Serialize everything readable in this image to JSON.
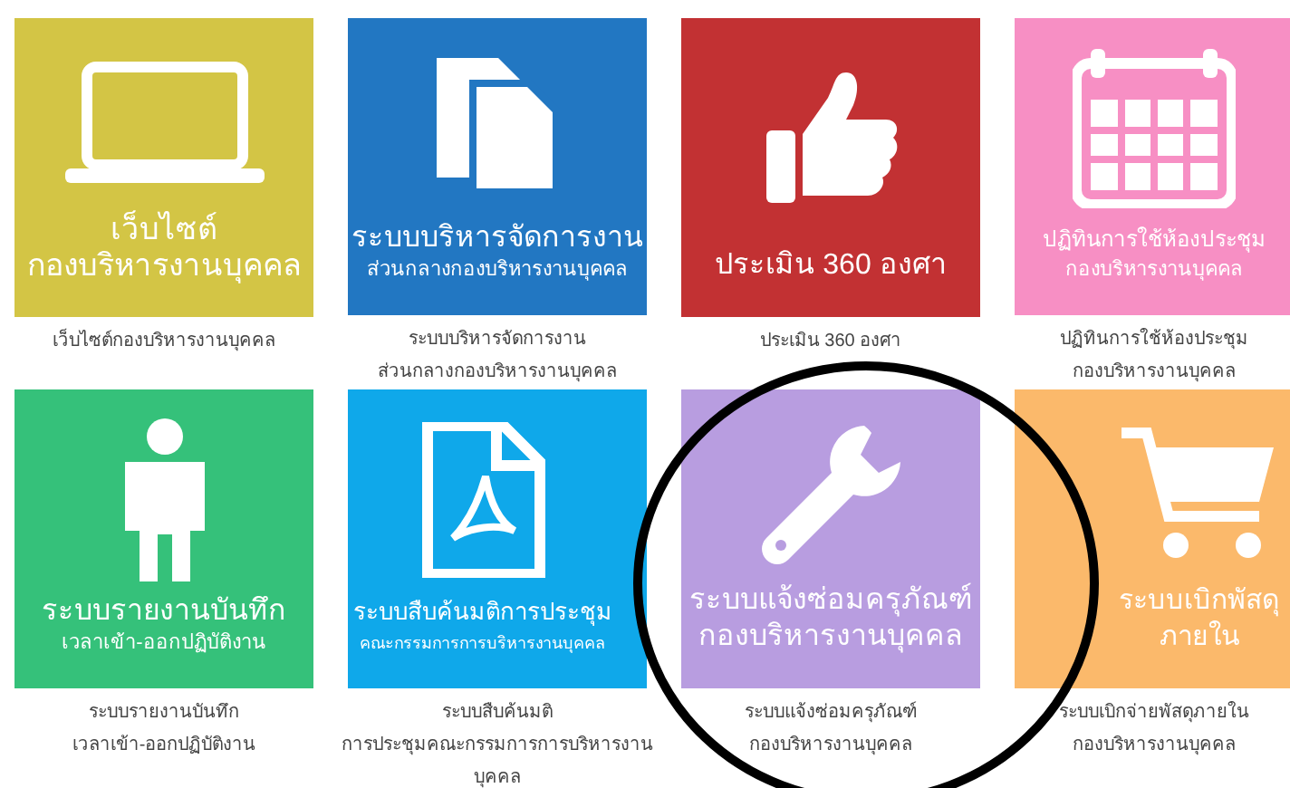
{
  "tiles": [
    {
      "title_lines": [
        "เว็บไซต์",
        "กองบริหารงานบุคคล"
      ],
      "color": "#d3c545",
      "caption_lines": [
        "เว็บไซต์กองบริหารงานบุคคล"
      ]
    },
    {
      "title_lines": [
        "ระบบบริหารจัดการงาน"
      ],
      "subtitle": "ส่วนกลางกองบริหารงานบุคคล",
      "color": "#2277c2",
      "caption_lines": [
        "ระบบบริหารจัดการงาน",
        "ส่วนกลางกองบริหารงานบุคคล"
      ]
    },
    {
      "title_lines": [
        "ประเมิน 360 องศา"
      ],
      "color": "#c23133",
      "caption_lines": [
        "ประเมิน 360 องศา"
      ]
    },
    {
      "title_lines": [
        "ปฏิทินการใช้ห้องประชุม"
      ],
      "subtitle": "กองบริหารงานบุคคล",
      "color": "#f78fc4",
      "caption_lines": [
        "ปฏิทินการใช้ห้องประชุม",
        "กองบริหารงานบุคคล"
      ]
    },
    {
      "title_lines": [
        "ระบบรายงานบันทึก"
      ],
      "subtitle": "เวลาเข้า-ออกปฏิบัติงาน",
      "color": "#35c17a",
      "caption_lines": [
        "ระบบรายงานบันทึก",
        "เวลาเข้า-ออกปฏิบัติงาน"
      ]
    },
    {
      "title_lines": [
        "ระบบสืบค้นมติการประชุม"
      ],
      "subtitle": "คณะกรรมการการบริหารงานบุคคล",
      "color": "#0fa8ea",
      "caption_lines": [
        "ระบบสืบค้นมติ",
        "การประชุมคณะกรรมการการบริหารงาน",
        "บุคคล"
      ]
    },
    {
      "title_lines": [
        "ระบบแจ้งซ่อมครุภัณฑ์",
        "กองบริหารงานบุคคล"
      ],
      "color": "#b89de0",
      "caption_lines": [
        "ระบบแจ้งซ่อมครุภัณฑ์",
        "กองบริหารงานบุคคล"
      ]
    },
    {
      "title_lines": [
        "ระบบเบิกพัสดุ",
        "ภายใน"
      ],
      "color": "#fbb96b",
      "caption_lines": [
        "ระบบเบิกจ่ายพัสดุภายใน",
        "กองบริหารงานบุคคล"
      ]
    }
  ]
}
